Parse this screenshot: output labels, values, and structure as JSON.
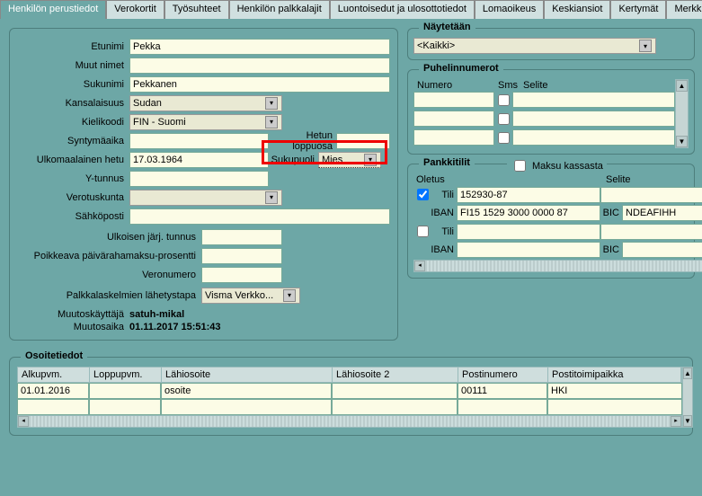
{
  "tabs": [
    "Henkilön perustiedot",
    "Verokortit",
    "Työsuhteet",
    "Henkilön palkkalajit",
    "Luontoisedut ja ulosottotiedot",
    "Lomaoikeus",
    "Keskiansiot",
    "Kertymät",
    "Merkkipäivät"
  ],
  "labels": {
    "etunimi": "Etunimi",
    "muut": "Muut nimet",
    "sukunimi": "Sukunimi",
    "kansal": "Kansalaisuus",
    "kieli": "Kielikoodi",
    "synt": "Syntymäaika",
    "hetuloppu": "Hetun loppuosa",
    "ulkhetu": "Ulkomaalainen hetu",
    "sukupuoli": "Sukupuoli",
    "ytunnus": "Y-tunnus",
    "verotusk": "Verotuskunta",
    "sahkoposti": "Sähköposti",
    "ulktunnus": "Ulkoisen järj. tunnus",
    "poikkeava": "Poikkeava päivärahamaksu-prosentti",
    "veronro": "Veronumero",
    "lahetys": "Palkkalaskelmien lähetystapa",
    "mkayttaja": "Muutoskäyttäjä",
    "maika": "Muutosaika"
  },
  "values": {
    "etunimi": "Pekka",
    "muut": "",
    "sukunimi": "Pekkanen",
    "kansal": "Sudan",
    "kieli": "FIN - Suomi",
    "synt": "",
    "hetuloppu": "",
    "ulkhetu": "17.03.1964",
    "sukupuoli": "Mies",
    "ytunnus": "",
    "verotusk": "",
    "sahkoposti": "",
    "ulktunnus": "",
    "poikkeava": "",
    "veronro": "",
    "lahetys": "Visma Verkko...",
    "mkayttaja": "satuh-mikal",
    "maika": "01.11.2017 15:51:43"
  },
  "naytetaan": {
    "title": "Näytetään",
    "value": "<Kaikki>"
  },
  "puhelin": {
    "title": "Puhelinnumerot",
    "cols": {
      "numero": "Numero",
      "sms": "Sms",
      "selite": "Selite"
    }
  },
  "pankki": {
    "title": "Pankkitilit",
    "maksukassasta": "Maksu kassasta",
    "cols": {
      "oletus": "Oletus",
      "tili": "Tili",
      "selite": "Selite",
      "iban": "IBAN",
      "bic": "BIC"
    },
    "rows": [
      {
        "oletus": true,
        "tili": "152930-87",
        "iban": "FI15 1529 3000 0000 87",
        "bic": "NDEAFIHH",
        "selite": ""
      },
      {
        "oletus": false,
        "tili": "",
        "iban": "",
        "bic": "",
        "selite": ""
      }
    ]
  },
  "osoite": {
    "title": "Osoitetiedot",
    "cols": {
      "alku": "Alkupvm.",
      "loppu": "Loppupvm.",
      "lahi": "Lähiosoite",
      "lahi2": "Lähiosoite 2",
      "postino": "Postinumero",
      "postitp": "Postitoimipaikka"
    },
    "rows": [
      {
        "alku": "01.01.2016",
        "loppu": "",
        "lahi": "osoite",
        "lahi2": "",
        "postino": "00111",
        "postitp": "HKI"
      },
      {
        "alku": "",
        "loppu": "",
        "lahi": "",
        "lahi2": "",
        "postino": "",
        "postitp": ""
      }
    ]
  }
}
